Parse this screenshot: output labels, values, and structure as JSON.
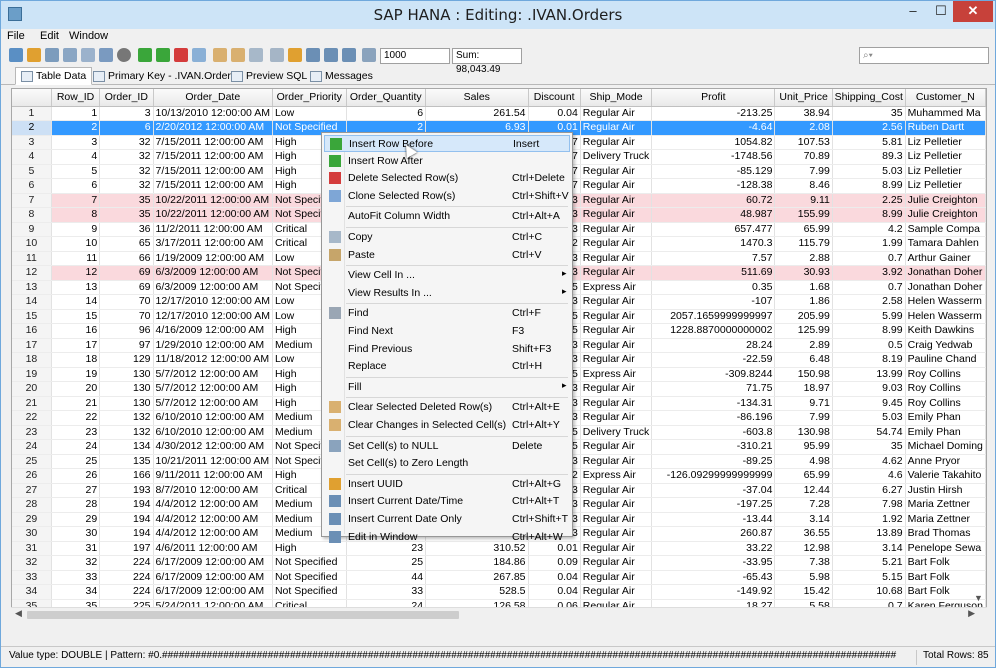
{
  "window": {
    "title": "SAP HANA : Editing: .IVAN.Orders",
    "minimize": "–",
    "maximize": "☐",
    "close": "✕"
  },
  "menu": [
    "File",
    "Edit",
    "Window"
  ],
  "toolbar": {
    "max_rows_value": "1000",
    "sum_label": "Sum: 98,043.49",
    "search_placeholder": "⌕▾"
  },
  "tabs": [
    "Table Data",
    "Primary Key - .IVAN.Orders",
    "Preview SQL",
    "Messages"
  ],
  "grid": {
    "columns": [
      "",
      "Row_ID",
      "Order_ID",
      "Order_Date",
      "Order_Priority",
      "Order_Quantity",
      "Sales",
      "Discount",
      "Ship_Mode",
      "Profit",
      "Unit_Price",
      "Shipping_Cost",
      "Customer_N"
    ],
    "rows": [
      [
        "1",
        "1",
        "3",
        "10/13/2010 12:00:00 AM",
        "Low",
        "6",
        "261.54",
        "0.04",
        "Regular Air",
        "-213.25",
        "38.94",
        "35",
        "Muhammed Ma"
      ],
      [
        "2",
        "2",
        "6",
        "2/20/2012 12:00:00 AM",
        "Not Specified",
        "2",
        "6.93",
        "0.01",
        "Regular Air",
        "-4.64",
        "2.08",
        "2.56",
        "Ruben Dartt"
      ],
      [
        "3",
        "3",
        "32",
        "7/15/2011 12:00:00 AM",
        "High",
        "",
        "",
        "7",
        "Regular Air",
        "1054.82",
        "107.53",
        "5.81",
        "Liz Pelletier"
      ],
      [
        "4",
        "4",
        "32",
        "7/15/2011 12:00:00 AM",
        "High",
        "",
        "",
        "7",
        "Delivery Truck",
        "-1748.56",
        "70.89",
        "89.3",
        "Liz Pelletier"
      ],
      [
        "5",
        "5",
        "32",
        "7/15/2011 12:00:00 AM",
        "High",
        "",
        "",
        "7",
        "Regular Air",
        "-85.129",
        "7.99",
        "5.03",
        "Liz Pelletier"
      ],
      [
        "6",
        "6",
        "32",
        "7/15/2011 12:00:00 AM",
        "High",
        "",
        "",
        "7",
        "Regular Air",
        "-128.38",
        "8.46",
        "8.99",
        "Liz Pelletier"
      ],
      [
        "7",
        "7",
        "35",
        "10/22/2011 12:00:00 AM",
        "Not Specified",
        "",
        "",
        "3",
        "Regular Air",
        "60.72",
        "9.11",
        "2.25",
        "Julie Creighton"
      ],
      [
        "8",
        "8",
        "35",
        "10/22/2011 12:00:00 AM",
        "Not Specified",
        "",
        "",
        "3",
        "Regular Air",
        "48.987",
        "155.99",
        "8.99",
        "Julie Creighton"
      ],
      [
        "9",
        "9",
        "36",
        "11/2/2011 12:00:00 AM",
        "Critical",
        "",
        "",
        "3",
        "Regular Air",
        "657.477",
        "65.99",
        "4.2",
        "Sample Compa"
      ],
      [
        "10",
        "10",
        "65",
        "3/17/2011 12:00:00 AM",
        "Critical",
        "",
        "",
        "2",
        "Regular Air",
        "1470.3",
        "115.79",
        "1.99",
        "Tamara Dahlen"
      ],
      [
        "11",
        "11",
        "66",
        "1/19/2009 12:00:00 AM",
        "Low",
        "",
        "",
        "3",
        "Regular Air",
        "7.57",
        "2.88",
        "0.7",
        "Arthur Gainer"
      ],
      [
        "12",
        "12",
        "69",
        "6/3/2009 12:00:00 AM",
        "Not Specified",
        "",
        "",
        "3",
        "Regular Air",
        "511.69",
        "30.93",
        "3.92",
        "Jonathan Doher"
      ],
      [
        "13",
        "13",
        "69",
        "6/3/2009 12:00:00 AM",
        "Not Specified",
        "",
        "",
        "5",
        "Express Air",
        "0.35",
        "1.68",
        "0.7",
        "Jonathan Doher"
      ],
      [
        "14",
        "14",
        "70",
        "12/17/2010 12:00:00 AM",
        "Low",
        "",
        "",
        "3",
        "Regular Air",
        "-107",
        "1.86",
        "2.58",
        "Helen Wasserm"
      ],
      [
        "15",
        "15",
        "70",
        "12/17/2010 12:00:00 AM",
        "Low",
        "",
        "",
        "5",
        "Regular Air",
        "2057.1659999999997",
        "205.99",
        "5.99",
        "Helen Wasserm"
      ],
      [
        "16",
        "16",
        "96",
        "4/16/2009 12:00:00 AM",
        "High",
        "",
        "",
        "5",
        "Regular Air",
        "1228.8870000000002",
        "125.99",
        "8.99",
        "Keith Dawkins"
      ],
      [
        "17",
        "17",
        "97",
        "1/29/2010 12:00:00 AM",
        "Medium",
        "",
        "",
        "3",
        "Regular Air",
        "28.24",
        "2.89",
        "0.5",
        "Craig Yedwab"
      ],
      [
        "18",
        "18",
        "129",
        "11/18/2012 12:00:00 AM",
        "Low",
        "",
        "",
        "3",
        "Regular Air",
        "-22.59",
        "6.48",
        "8.19",
        "Pauline Chand"
      ],
      [
        "19",
        "19",
        "130",
        "5/7/2012 12:00:00 AM",
        "High",
        "",
        "",
        "5",
        "Express Air",
        "-309.8244",
        "150.98",
        "13.99",
        "Roy Collins"
      ],
      [
        "20",
        "20",
        "130",
        "5/7/2012 12:00:00 AM",
        "High",
        "",
        "",
        "3",
        "Regular Air",
        "71.75",
        "18.97",
        "9.03",
        "Roy Collins"
      ],
      [
        "21",
        "21",
        "130",
        "5/7/2012 12:00:00 AM",
        "High",
        "",
        "",
        "3",
        "Regular Air",
        "-134.31",
        "9.71",
        "9.45",
        "Roy Collins"
      ],
      [
        "22",
        "22",
        "132",
        "6/10/2010 12:00:00 AM",
        "Medium",
        "",
        "",
        "3",
        "Regular Air",
        "-86.196",
        "7.99",
        "5.03",
        "Emily Phan"
      ],
      [
        "23",
        "23",
        "132",
        "6/10/2010 12:00:00 AM",
        "Medium",
        "",
        "",
        "5",
        "Delivery Truck",
        "-603.8",
        "130.98",
        "54.74",
        "Emily Phan"
      ],
      [
        "24",
        "24",
        "134",
        "4/30/2012 12:00:00 AM",
        "Not Specified",
        "",
        "",
        "5",
        "Regular Air",
        "-310.21",
        "95.99",
        "35",
        "Michael Doming"
      ],
      [
        "25",
        "25",
        "135",
        "10/21/2011 12:00:00 AM",
        "Not Specified",
        "",
        "",
        "3",
        "Regular Air",
        "-89.25",
        "4.98",
        "4.62",
        "Anne Pryor"
      ],
      [
        "26",
        "26",
        "166",
        "9/11/2011 12:00:00 AM",
        "High",
        "",
        "",
        "2",
        "Express Air",
        "-126.09299999999999",
        "65.99",
        "4.6",
        "Valerie Takahito"
      ],
      [
        "27",
        "27",
        "193",
        "8/7/2010 12:00:00 AM",
        "Critical",
        "",
        "",
        "3",
        "Regular Air",
        "-37.04",
        "12.44",
        "6.27",
        "Justin Hirsh"
      ],
      [
        "28",
        "28",
        "194",
        "4/4/2012 12:00:00 AM",
        "Medium",
        "",
        "",
        "3",
        "Regular Air",
        "-197.25",
        "7.28",
        "7.98",
        "Maria Zettner"
      ],
      [
        "29",
        "29",
        "194",
        "4/4/2012 12:00:00 AM",
        "Medium",
        "",
        "",
        "3",
        "Regular Air",
        "-13.44",
        "3.14",
        "1.92",
        "Maria Zettner"
      ],
      [
        "30",
        "30",
        "194",
        "4/4/2012 12:00:00 AM",
        "Medium",
        "",
        "",
        "3",
        "Regular Air",
        "260.87",
        "36.55",
        "13.89",
        "Brad Thomas"
      ],
      [
        "31",
        "31",
        "197",
        "4/6/2011 12:00:00 AM",
        "High",
        "23",
        "310.52",
        "0.01",
        "Regular Air",
        "33.22",
        "12.98",
        "3.14",
        "Penelope Sewa"
      ],
      [
        "32",
        "32",
        "224",
        "6/17/2009 12:00:00 AM",
        "Not Specified",
        "25",
        "184.86",
        "0.09",
        "Regular Air",
        "-33.95",
        "7.38",
        "5.21",
        "Bart Folk"
      ],
      [
        "33",
        "33",
        "224",
        "6/17/2009 12:00:00 AM",
        "Not Specified",
        "44",
        "267.85",
        "0.04",
        "Regular Air",
        "-65.43",
        "5.98",
        "5.15",
        "Bart Folk"
      ],
      [
        "34",
        "34",
        "224",
        "6/17/2009 12:00:00 AM",
        "Not Specified",
        "33",
        "528.5",
        "0.04",
        "Regular Air",
        "-149.92",
        "15.42",
        "10.68",
        "Bart Folk"
      ],
      [
        "35",
        "35",
        "225",
        "5/24/2011 12:00:00 AM",
        "Critical",
        "24",
        "126.58",
        "0.06",
        "Regular Air",
        "18.27",
        "5.58",
        "0.7",
        "Karen Ferguson"
      ]
    ]
  },
  "context_menu": [
    {
      "label": "Insert Row Before",
      "shortcut": "Insert",
      "icon": "insert-row-before-icon"
    },
    {
      "label": "Insert Row After",
      "shortcut": "",
      "icon": "insert-row-after-icon"
    },
    {
      "label": "Delete Selected Row(s)",
      "shortcut": "Ctrl+Delete",
      "icon": "delete-row-icon"
    },
    {
      "label": "Clone Selected Row(s)",
      "shortcut": "Ctrl+Shift+V",
      "icon": "clone-row-icon"
    },
    {
      "label": "AutoFit Column Width",
      "shortcut": "Ctrl+Alt+A",
      "icon": ""
    },
    {
      "label": "Copy",
      "shortcut": "Ctrl+C",
      "icon": "copy-icon"
    },
    {
      "label": "Paste",
      "shortcut": "Ctrl+V",
      "icon": "paste-icon"
    },
    {
      "label": "View Cell In ...",
      "shortcut": "",
      "icon": ""
    },
    {
      "label": "View Results In ...",
      "shortcut": "",
      "icon": ""
    },
    {
      "label": "Find",
      "shortcut": "Ctrl+F",
      "icon": "find-icon"
    },
    {
      "label": "Find Next",
      "shortcut": "F3",
      "icon": ""
    },
    {
      "label": "Find Previous",
      "shortcut": "Shift+F3",
      "icon": ""
    },
    {
      "label": "Replace",
      "shortcut": "Ctrl+H",
      "icon": ""
    },
    {
      "label": "Fill",
      "shortcut": "",
      "icon": ""
    },
    {
      "label": "Clear Selected Deleted Row(s)",
      "shortcut": "Ctrl+Alt+E",
      "icon": "clear-deleted-icon"
    },
    {
      "label": "Clear Changes in Selected Cell(s)",
      "shortcut": "Ctrl+Alt+Y",
      "icon": "clear-changes-icon"
    },
    {
      "label": "Set Cell(s) to NULL",
      "shortcut": "Delete",
      "icon": "set-null-icon"
    },
    {
      "label": "Set Cell(s) to Zero Length",
      "shortcut": "",
      "icon": ""
    },
    {
      "label": "Insert UUID",
      "shortcut": "Ctrl+Alt+G",
      "icon": "uuid-icon"
    },
    {
      "label": "Insert Current Date/Time",
      "shortcut": "Ctrl+Alt+T",
      "icon": "datetime-icon"
    },
    {
      "label": "Insert Current Date Only",
      "shortcut": "Ctrl+Shift+T",
      "icon": "date-icon"
    },
    {
      "label": "Edit in Window",
      "shortcut": "Ctrl+Alt+W",
      "icon": "edit-window-icon"
    }
  ],
  "status": {
    "left": "Value type: DOUBLE | Pattern: #0.####################################################################################################################################",
    "right": "Total Rows: 85"
  },
  "colors": {
    "selection": "#3399ff",
    "deleted_row": "#fad9dd",
    "title_bg": "#cde4f7"
  }
}
